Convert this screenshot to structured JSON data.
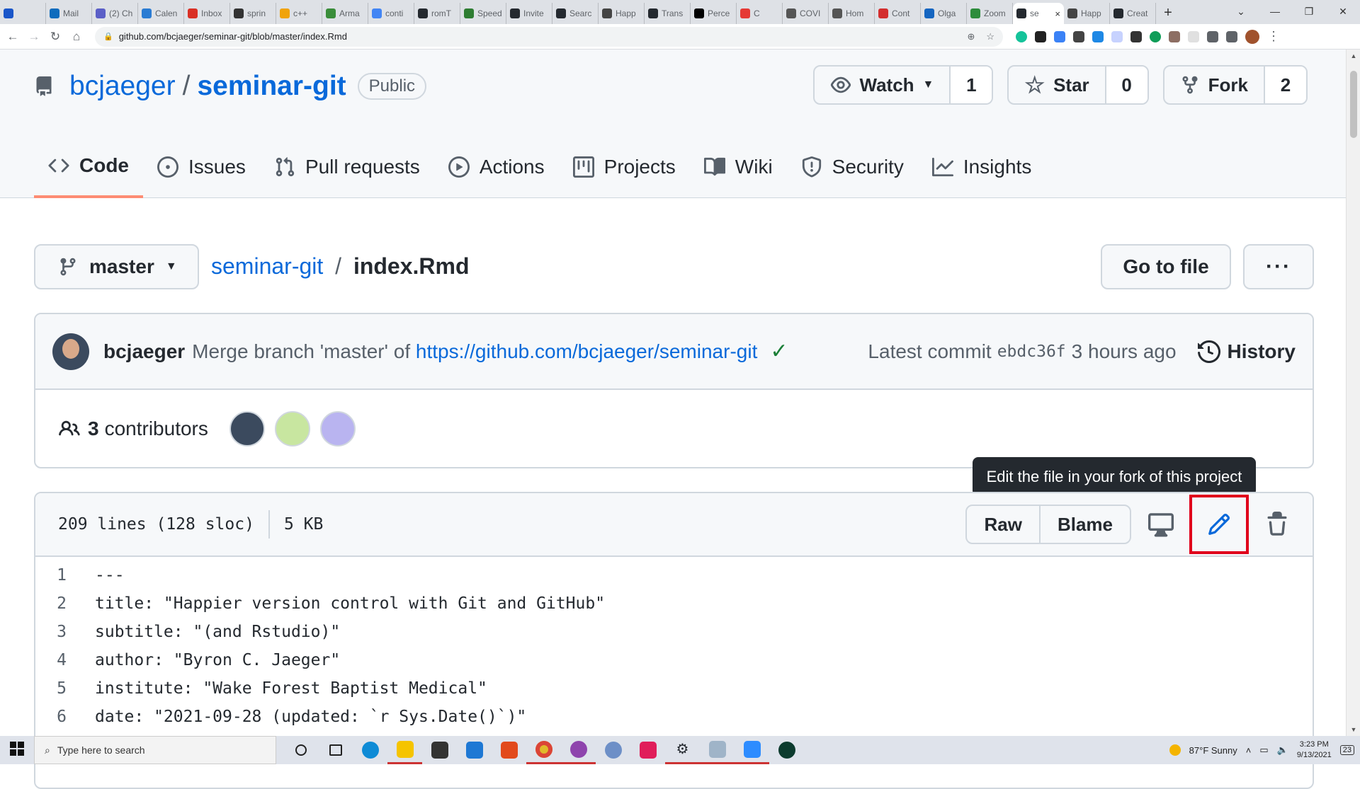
{
  "browser": {
    "tabs": [
      {
        "label": "",
        "color": "#1a56c9"
      },
      {
        "label": "Mail",
        "color": "#0f6cbd"
      },
      {
        "label": "(2) Ch",
        "color": "#5b5fc7"
      },
      {
        "label": "Calen",
        "color": "#2b7cd3"
      },
      {
        "label": "Inbox",
        "color": "#d93025"
      },
      {
        "label": "sprin",
        "color": "#333333"
      },
      {
        "label": "c++",
        "color": "#f0a30a"
      },
      {
        "label": "Arma",
        "color": "#3a8d3a"
      },
      {
        "label": "conti",
        "color": "#4285f4"
      },
      {
        "label": "romT",
        "color": "#24292f"
      },
      {
        "label": "Speed",
        "color": "#2e7d32"
      },
      {
        "label": "Invite",
        "color": "#24292f"
      },
      {
        "label": "Searc",
        "color": "#24292f"
      },
      {
        "label": "Happ",
        "color": "#444444"
      },
      {
        "label": "Trans",
        "color": "#24292f"
      },
      {
        "label": "Perce",
        "color": "#000000"
      },
      {
        "label": "C",
        "color": "#e53935"
      },
      {
        "label": "COVI",
        "color": "#555555"
      },
      {
        "label": "Hom",
        "color": "#555555"
      },
      {
        "label": "Cont",
        "color": "#d32f2f"
      },
      {
        "label": "Olga",
        "color": "#1565c0"
      },
      {
        "label": "Zoom",
        "color": "#2d8c3c"
      },
      {
        "label": "se",
        "color": "#24292f",
        "active": true
      },
      {
        "label": "Happ",
        "color": "#444444"
      },
      {
        "label": "Creat",
        "color": "#24292f"
      }
    ],
    "new_tab": "+",
    "url": "github.com/bcjaeger/seminar-git/blob/master/index.Rmd"
  },
  "repo": {
    "owner": "bcjaeger",
    "slash": "/",
    "name": "seminar-git",
    "visibility": "Public",
    "watch": {
      "label": "Watch",
      "count": "1"
    },
    "star": {
      "label": "Star",
      "count": "0"
    },
    "fork": {
      "label": "Fork",
      "count": "2"
    }
  },
  "nav": {
    "tabs": [
      {
        "label": "Code",
        "icon": "code-icon"
      },
      {
        "label": "Issues",
        "icon": "issues-icon"
      },
      {
        "label": "Pull requests",
        "icon": "pull-request-icon"
      },
      {
        "label": "Actions",
        "icon": "play-icon"
      },
      {
        "label": "Projects",
        "icon": "project-icon"
      },
      {
        "label": "Wiki",
        "icon": "book-icon"
      },
      {
        "label": "Security",
        "icon": "shield-icon"
      },
      {
        "label": "Insights",
        "icon": "graph-icon"
      }
    ]
  },
  "file": {
    "branch": "master",
    "repo_link": "seminar-git",
    "sep": "/",
    "filename": "index.Rmd",
    "go_to_file": "Go to file",
    "more": "···"
  },
  "commit": {
    "author": "bcjaeger",
    "message_prefix": "Merge branch 'master' of",
    "message_link": "https://github.com/bcjaeger/seminar-git",
    "latest_label": "Latest commit",
    "sha": "ebdc36f",
    "time": "3 hours ago",
    "history": "History"
  },
  "contributors": {
    "count": "3",
    "label": "contributors",
    "avatar_colors": [
      "#3b4a5e",
      "#c8e6a0",
      "#b9b4f0"
    ]
  },
  "file_meta": {
    "lines": "209 lines (128 sloc)",
    "size": "5 KB",
    "raw": "Raw",
    "blame": "Blame",
    "tooltip": "Edit the file in your fork of this project"
  },
  "code_lines": [
    {
      "n": "1",
      "t": "---"
    },
    {
      "n": "2",
      "t": "title: \"Happier version control with Git and GitHub\""
    },
    {
      "n": "3",
      "t": "subtitle: \"(and Rstudio)\""
    },
    {
      "n": "4",
      "t": "author: \"Byron C. Jaeger\""
    },
    {
      "n": "5",
      "t": "institute: \"Wake Forest Baptist Medical\""
    },
    {
      "n": "6",
      "t": "date: \"2021-09-28 (updated: `r Sys.Date()`)\""
    }
  ],
  "taskbar": {
    "search_placeholder": "Type here to search",
    "weather": "87°F  Sunny",
    "time": "3:23 PM",
    "date": "9/13/2021",
    "notif": "23"
  }
}
